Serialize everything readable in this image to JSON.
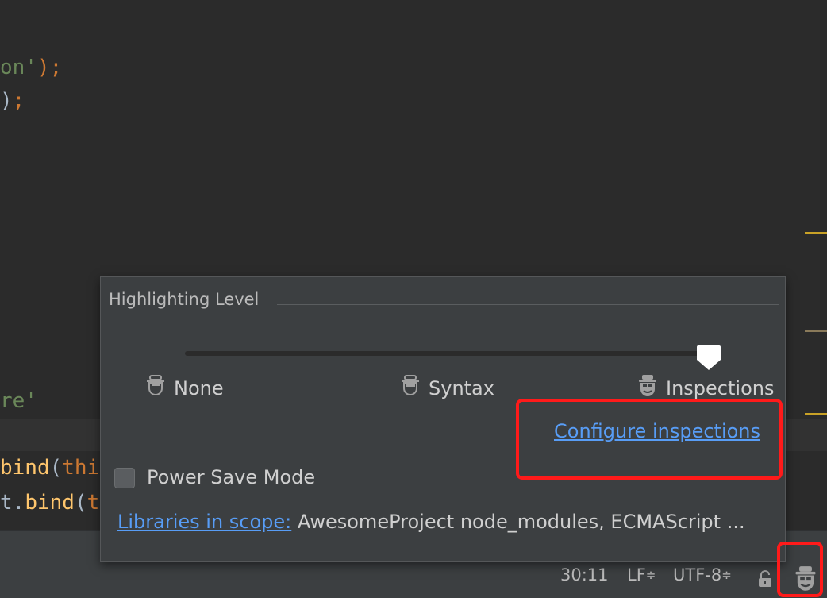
{
  "editor": {
    "line1": {
      "a": "on'",
      "b": ");"
    },
    "line2": {
      "a": ")",
      "b": ";"
    },
    "line3": {
      "a": "re'"
    },
    "line4": {
      "a": "bind",
      "b": "(",
      "c": "thi"
    },
    "line5": {
      "a": "t.",
      "b": "bind",
      "c": "(",
      "d": "this",
      "e": "));"
    }
  },
  "popup": {
    "title": "Highlighting Level",
    "levels": [
      "None",
      "Syntax",
      "Inspections"
    ],
    "selected_level": "Inspections",
    "configure_link": "Configure inspections",
    "power_save_label": "Power Save Mode",
    "power_save_checked": false,
    "libraries_link": "Libraries in scope:",
    "libraries_value": "AwesomeProject node_modules, ECMAScript ..."
  },
  "statusbar": {
    "position": "30:11",
    "line_separator": "LF",
    "encoding": "UTF-8",
    "arrows": "≑"
  },
  "colors": {
    "highlight_box": "#ff1a1a",
    "link": "#589df6",
    "marker": "#c9a227"
  },
  "icons": [
    "hector-icon",
    "lock-icon",
    "thumb-icon"
  ]
}
